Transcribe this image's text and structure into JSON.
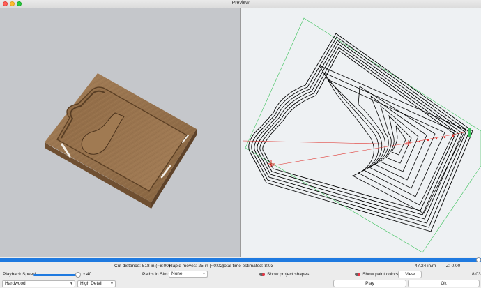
{
  "window": {
    "title": "Preview"
  },
  "stats": {
    "cut_distance": "Cut distance: 518 in (~8:00)",
    "rapid_moves": "Rapid moves: 25 in (~0:02)",
    "total_time": "Total time estimated: 8:03",
    "feed_rate": "47.24 in/m",
    "z_position": "Z: 0.00"
  },
  "controls": {
    "playback_label": "Playback Speed",
    "playback_value": "x 40",
    "playback_fraction": 0.97,
    "progress_fraction": 1.0,
    "elapsed": "8:03",
    "material": "Hardwood",
    "detail": "High Detail",
    "paths_label": "Paths in Sim:",
    "paths_value": "None",
    "show_shapes": "Show project shapes",
    "show_paint": "Show paint colors",
    "view_button": "View",
    "play_button": "Play",
    "ok_button": "Ok"
  },
  "colors": {
    "progress": "#1f7ae0",
    "toolpath": "#000000",
    "rapid": "#e0302a",
    "boundary": "#3ac25a",
    "wood": "#9c7650"
  },
  "icons": [
    "close-icon",
    "minimize-icon",
    "zoom-icon",
    "chevron-down-icon",
    "toggle-icon"
  ]
}
